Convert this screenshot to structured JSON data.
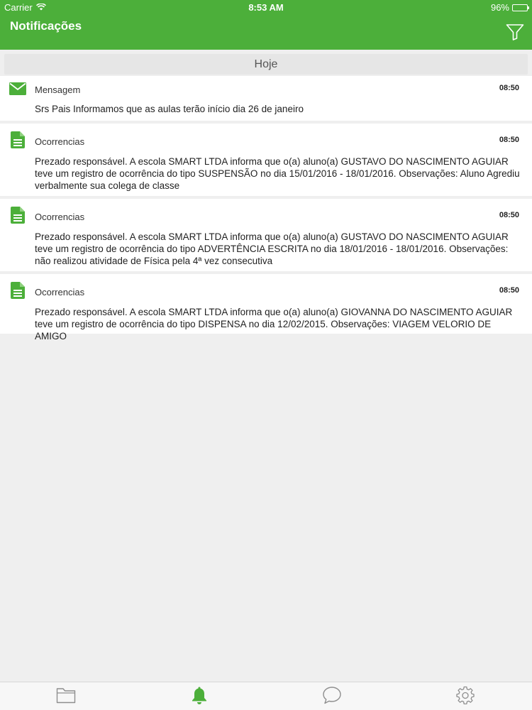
{
  "status_bar": {
    "carrier": "Carrier",
    "time": "8:53 AM",
    "battery": "96%"
  },
  "nav": {
    "title": "Notificações",
    "filter_icon": "funnel-icon"
  },
  "section": {
    "title": "Hoje"
  },
  "notifications": [
    {
      "type": "Mensagem",
      "icon": "envelope-icon",
      "time": "08:50",
      "message": "Srs Pais Informamos que as aulas terão início dia 26 de janeiro"
    },
    {
      "type": "Ocorrencias",
      "icon": "document-icon",
      "time": "08:50",
      "message": "Prezado responsável. A escola SMART LTDA informa que o(a) aluno(a) GUSTAVO DO NASCIMENTO AGUIAR teve um registro de ocorrência do tipo SUSPENSÃO no dia 15/01/2016 - 18/01/2016. Observações: Aluno Agrediu verbalmente sua colega de classe"
    },
    {
      "type": "Ocorrencias",
      "icon": "document-icon",
      "time": "08:50",
      "message": "Prezado responsável. A escola SMART LTDA informa que o(a) aluno(a) GUSTAVO DO NASCIMENTO AGUIAR teve um registro de ocorrência do tipo ADVERTÊNCIA ESCRITA no dia 18/01/2016 - 18/01/2016. Observações: não realizou atividade de Física pela 4ª vez consecutiva"
    },
    {
      "type": "Ocorrencias",
      "icon": "document-icon",
      "time": "08:50",
      "message": "Prezado responsável. A escola SMART LTDA informa que o(a) aluno(a) GIOVANNA DO NASCIMENTO AGUIAR teve um registro de ocorrência do tipo DISPENSA no dia 12/02/2015. Observações: VIAGEM VELORIO DE AMIGO"
    }
  ],
  "tabbar": {
    "tabs": [
      {
        "icon": "folder-icon",
        "active": false
      },
      {
        "icon": "bell-icon",
        "active": true
      },
      {
        "icon": "chat-bubble-icon",
        "active": false
      },
      {
        "icon": "gear-icon",
        "active": false
      }
    ]
  },
  "colors": {
    "brand_green": "#4caf3a",
    "icon_green": "#4caf3a",
    "tab_inactive": "#8e8e8e"
  }
}
